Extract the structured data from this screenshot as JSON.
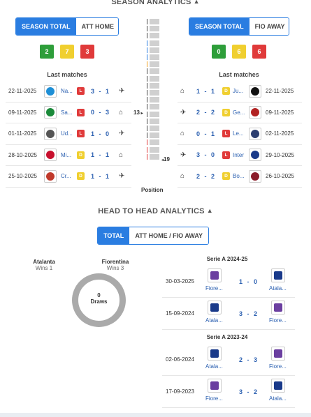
{
  "season": {
    "title": "SEASON ANALYTICS",
    "left_toggle": [
      "SEASON TOTAL",
      "ATT HOME"
    ],
    "right_toggle": [
      "SEASON TOTAL",
      "FIO AWAY"
    ],
    "left_pills": [
      "2",
      "7",
      "3"
    ],
    "right_pills": [
      "0",
      "6",
      "6"
    ],
    "last_matches_label": "Last matches",
    "left_matches": [
      {
        "date": "22-11-2025",
        "team": "Na...",
        "result": "L",
        "score": "3 - 1",
        "venue": "plane-icon",
        "crest": "#1e8fd6"
      },
      {
        "date": "09-11-2025",
        "team": "Sa...",
        "result": "L",
        "score": "0 - 3",
        "venue": "home-icon",
        "crest": "#1a8a3a"
      },
      {
        "date": "01-11-2025",
        "team": "Ud...",
        "result": "L",
        "score": "1 - 0",
        "venue": "plane-icon",
        "crest": "#555555"
      },
      {
        "date": "28-10-2025",
        "team": "Mi...",
        "result": "D",
        "score": "1 - 1",
        "venue": "home-icon",
        "crest": "#c8102e"
      },
      {
        "date": "25-10-2025",
        "team": "Cr...",
        "result": "D",
        "score": "1 - 1",
        "venue": "plane-icon",
        "crest": "#c0392b"
      }
    ],
    "right_matches": [
      {
        "date": "22-11-2025",
        "team": "Ju...",
        "result": "D",
        "score": "1 - 1",
        "venue": "home-icon",
        "crest": "#111111"
      },
      {
        "date": "09-11-2025",
        "team": "Ge...",
        "result": "D",
        "score": "2 - 2",
        "venue": "plane-icon",
        "crest": "#b22222"
      },
      {
        "date": "02-11-2025",
        "team": "Le...",
        "result": "L",
        "score": "0 - 1",
        "venue": "home-icon",
        "crest": "#2c3e70"
      },
      {
        "date": "29-10-2025",
        "team": "Inter",
        "result": "L",
        "score": "3 - 0",
        "venue": "plane-icon",
        "crest": "#1a3a8a"
      },
      {
        "date": "26-10-2025",
        "team": "Bo...",
        "result": "D",
        "score": "2 - 2",
        "venue": "home-icon",
        "crest": "#8b1c2a"
      }
    ],
    "position_label": "Position",
    "pos_left": "13",
    "pos_right": "19"
  },
  "h2h": {
    "title": "HEAD TO HEAD ANALYTICS",
    "toggle": [
      "TOTAL",
      "ATT HOME / FIO AWAY"
    ],
    "home_team": "Atalanta",
    "home_wins": "Wins 1",
    "away_team": "Fiorentina",
    "away_wins": "Wins 3",
    "draws_num": "0",
    "draws_label": "Draws",
    "seasons": [
      {
        "name": "Serie A 2024-25",
        "matches": [
          {
            "date": "30-03-2025",
            "home": "Fiore...",
            "away": "Atala...",
            "score": "1 - 0",
            "home_color": "#6b3fa0",
            "away_color": "#1a3a8a"
          },
          {
            "date": "15-09-2024",
            "home": "Atala...",
            "away": "Fiore...",
            "score": "3 - 2",
            "home_color": "#1a3a8a",
            "away_color": "#6b3fa0"
          }
        ]
      },
      {
        "name": "Serie A 2023-24",
        "matches": [
          {
            "date": "02-06-2024",
            "home": "Atala...",
            "away": "Fiore...",
            "score": "2 - 3",
            "home_color": "#1a3a8a",
            "away_color": "#6b3fa0"
          },
          {
            "date": "17-09-2023",
            "home": "Fiore...",
            "away": "Atala...",
            "score": "3 - 2",
            "home_color": "#6b3fa0",
            "away_color": "#1a3a8a"
          }
        ]
      }
    ]
  }
}
